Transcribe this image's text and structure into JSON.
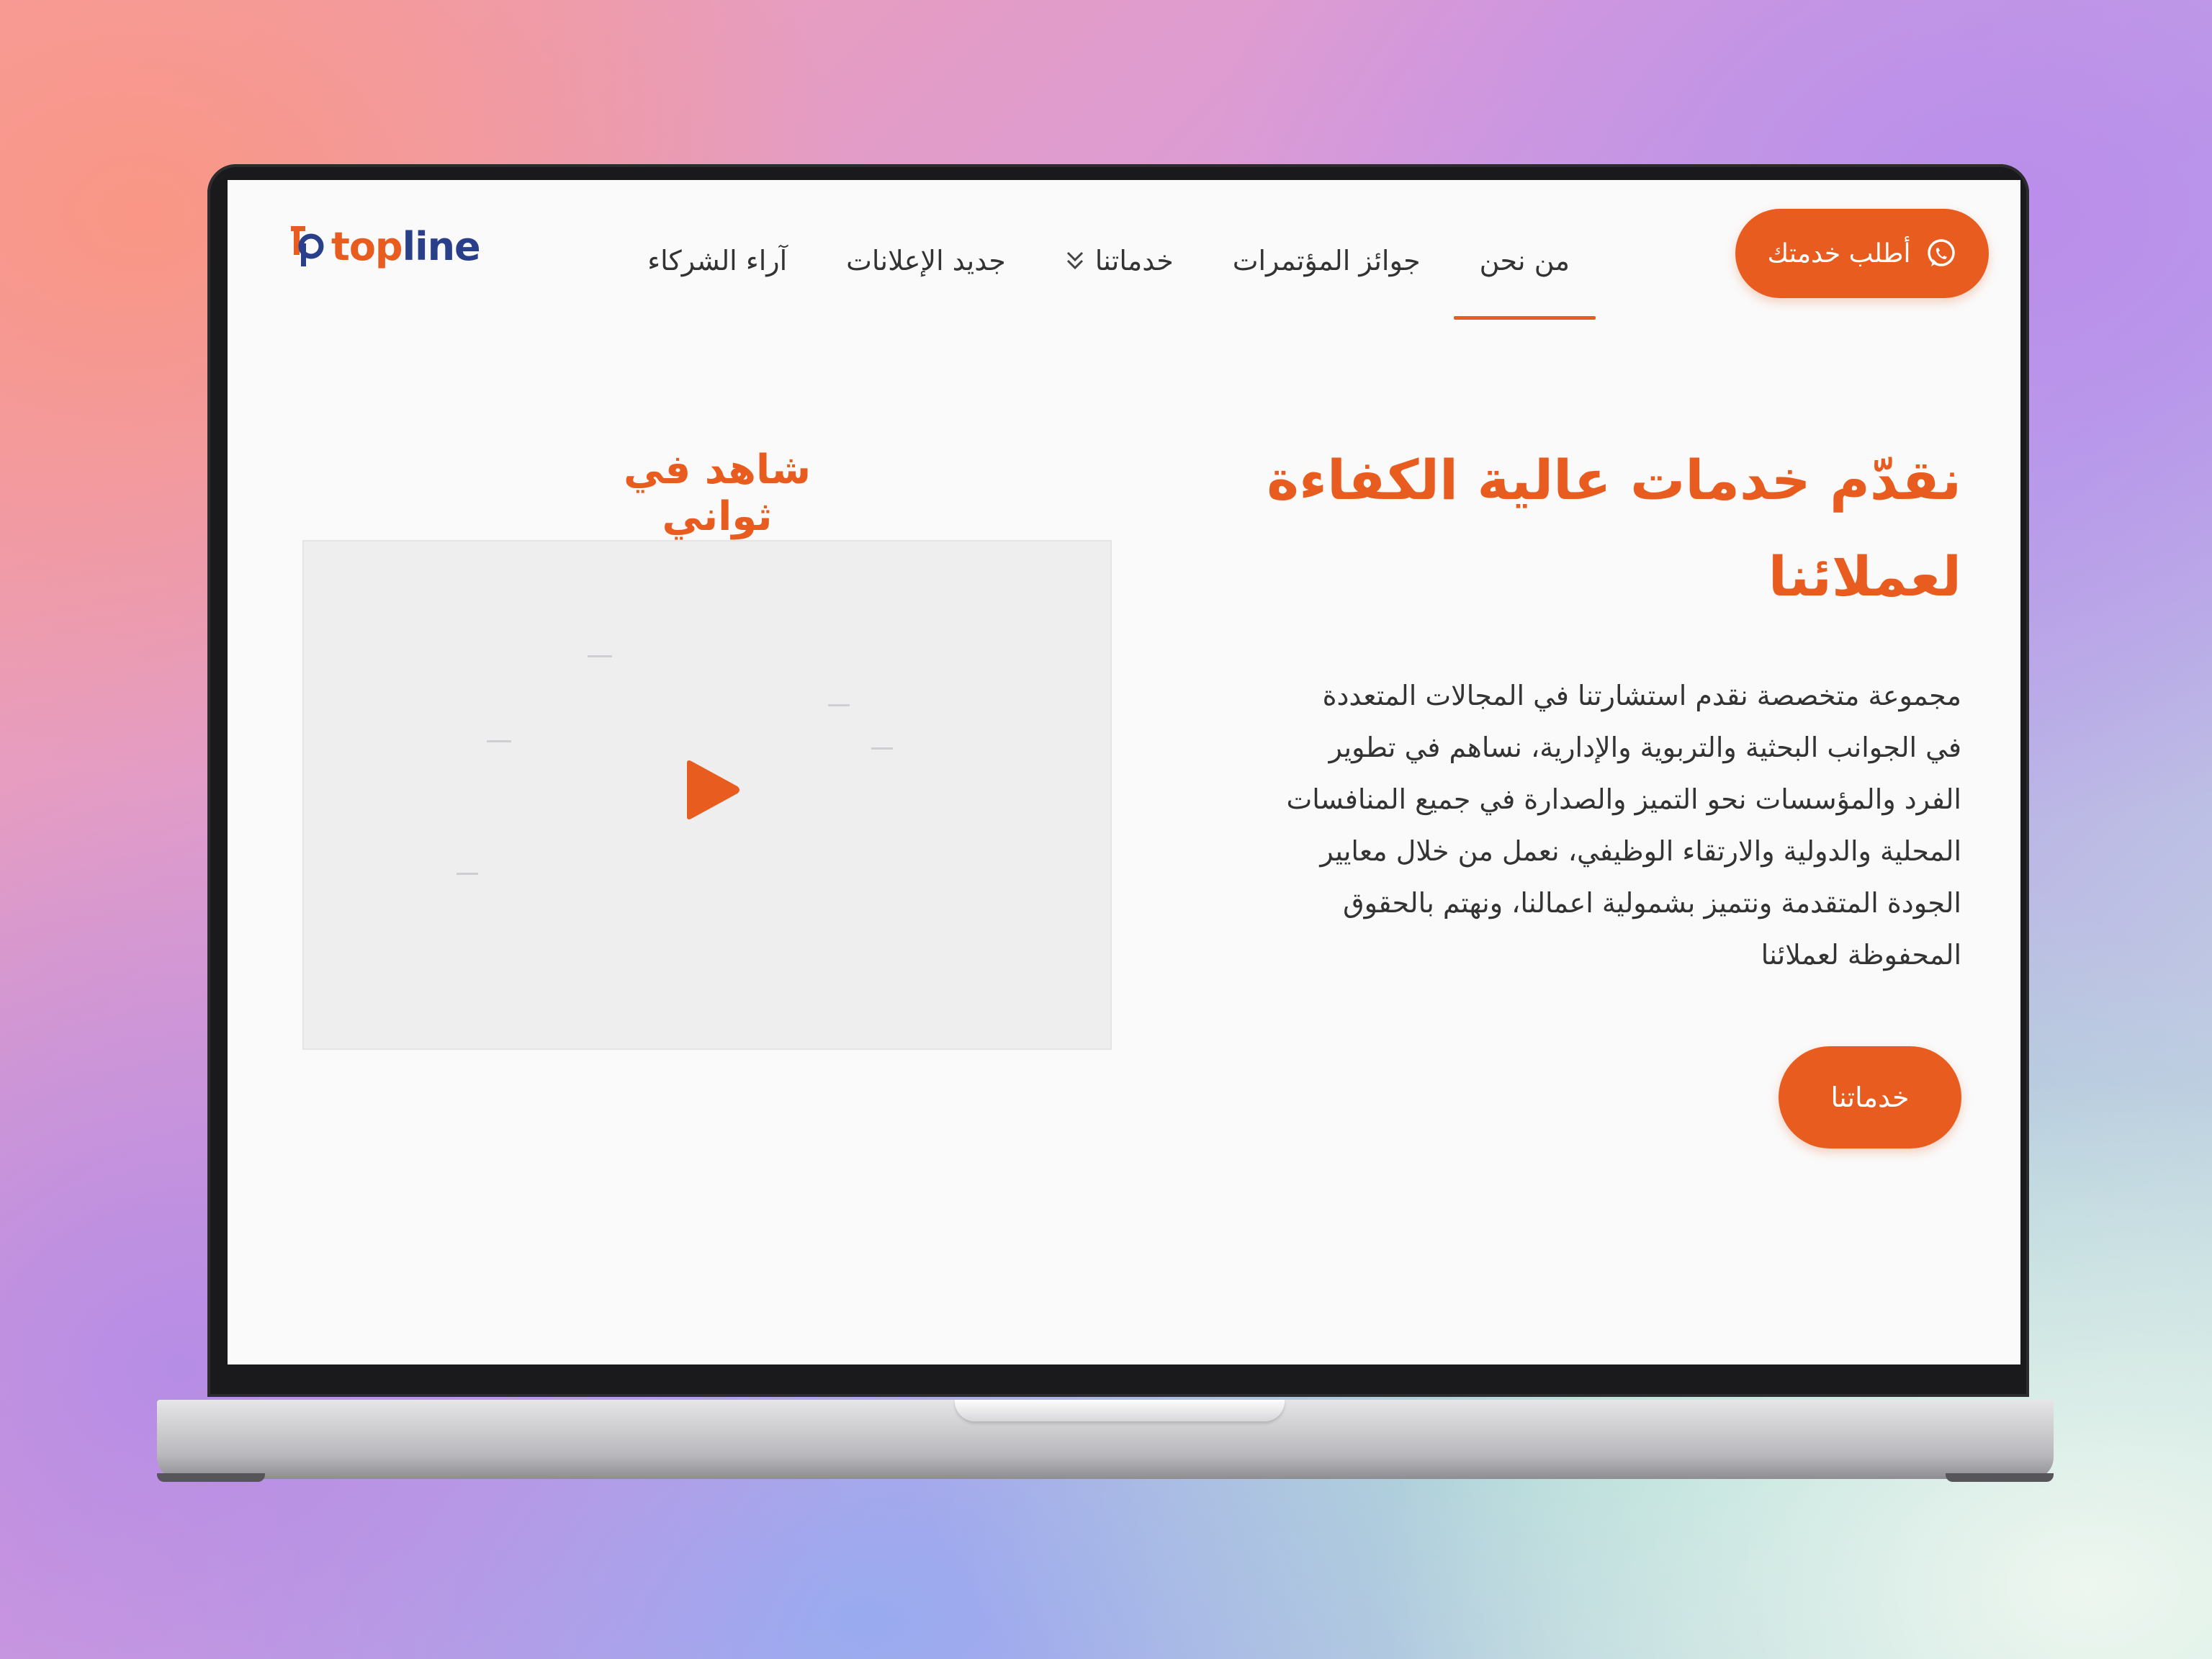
{
  "brand": {
    "logo_text_accent": "top",
    "logo_text_main": "line"
  },
  "nav": {
    "items": [
      {
        "label": "من نحن",
        "active": true
      },
      {
        "label": "جوائز المؤتمرات",
        "active": false
      },
      {
        "label": "خدماتنا",
        "active": false,
        "has_dropdown": true
      },
      {
        "label": "جديد الإعلانات",
        "active": false
      },
      {
        "label": "آراء الشركاء",
        "active": false
      }
    ],
    "cta_label": "أطلب خدمتك",
    "cta_icon": "whatsapp-icon"
  },
  "hero": {
    "title_line1": "نقدّم خدمات عالية الكفاءة",
    "title_line2": "لعملائنا",
    "body_lines": [
      "مجموعة متخصصة نقدم استشارتنا في المجالات المتعددة",
      "في الجوانب البحثية والتربوية والإدارية، نساهم في تطوير",
      "الفرد والمؤسسات نحو التميز والصدارة في جميع المنافسات",
      "المحلية والدولية والارتقاء الوظيفي، نعمل من خلال معايير",
      "الجودة المتقدمة ونتميز بشمولية اعمالنا، ونهتم بالحقوق",
      "المحفوظة لعملائنا"
    ],
    "services_button": "خدماتنا"
  },
  "video": {
    "title": "شاهد في ثواني",
    "play_icon": "play-icon"
  },
  "colors": {
    "accent": "#e85d1f",
    "brand_blue": "#2a3f8a",
    "screen_bg": "#fafafa",
    "text": "#333333"
  }
}
